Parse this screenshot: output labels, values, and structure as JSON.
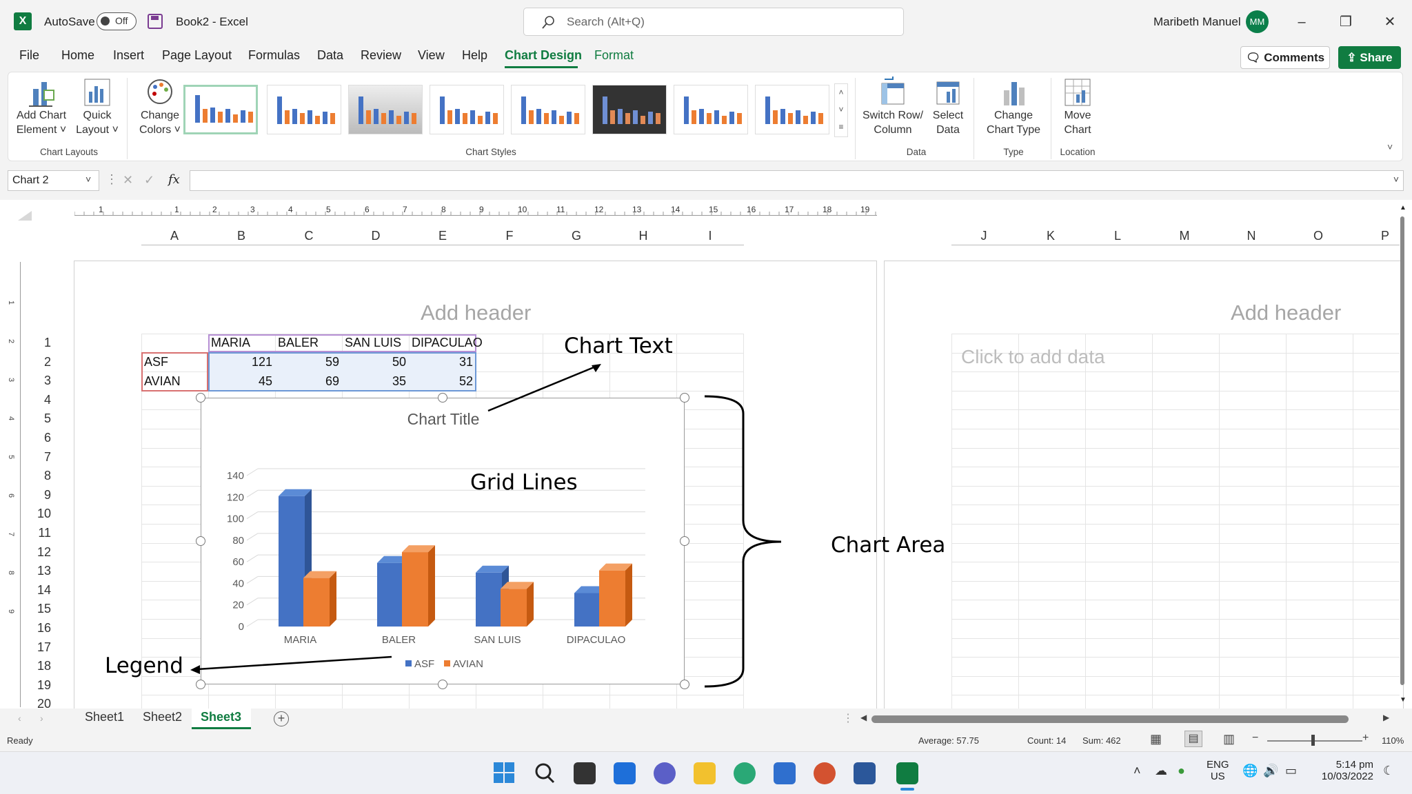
{
  "window": {
    "autosave_label": "AutoSave",
    "autosave_state": "Off",
    "title": "Book2  -  Excel",
    "search_placeholder": "Search (Alt+Q)",
    "user_name": "Maribeth Manuel",
    "user_initials": "MM"
  },
  "tabs": [
    "File",
    "Home",
    "Insert",
    "Page Layout",
    "Formulas",
    "Data",
    "Review",
    "View",
    "Help",
    "Chart Design",
    "Format"
  ],
  "actions": {
    "comments": "Comments",
    "share": "Share"
  },
  "ribbon": {
    "add_chart_element": [
      "Add Chart",
      "Element ˅"
    ],
    "quick_layout": [
      "Quick",
      "Layout ˅"
    ],
    "change_colors": [
      "Change",
      "Colors ˅"
    ],
    "switch_row_col": [
      "Switch Row/",
      "Column"
    ],
    "select_data": [
      "Select",
      "Data"
    ],
    "change_chart_type": [
      "Change",
      "Chart Type"
    ],
    "move_chart": [
      "Move",
      "Chart"
    ],
    "groups": {
      "chart_layouts": "Chart Layouts",
      "chart_styles": "Chart Styles",
      "data": "Data",
      "type": "Type",
      "location": "Location"
    }
  },
  "formula_bar": {
    "name_box": "Chart 2",
    "fx": "fx",
    "value": ""
  },
  "ruler_numbers": [
    "1",
    "1",
    "2",
    "3",
    "4",
    "5",
    "6",
    "7",
    "8",
    "9",
    "10",
    "11",
    "12",
    "13",
    "14",
    "15",
    "16",
    "17",
    "18",
    "19"
  ],
  "ruler_left_numbers": [
    "1",
    "2",
    "3",
    "4",
    "5",
    "6",
    "7",
    "8",
    "9"
  ],
  "columns_left": [
    "A",
    "B",
    "C",
    "D",
    "E",
    "F",
    "G",
    "H",
    "I"
  ],
  "columns_right": [
    "J",
    "K",
    "L",
    "M",
    "N",
    "O",
    "P"
  ],
  "rows": [
    "1",
    "2",
    "3",
    "4",
    "5",
    "6",
    "7",
    "8",
    "9",
    "10",
    "11",
    "12",
    "13",
    "14",
    "15",
    "16",
    "17",
    "18",
    "19",
    "20"
  ],
  "page": {
    "header_left": "Add header",
    "header_right": "Add header",
    "click_to_add": "Click to add data"
  },
  "table": {
    "headers": [
      "MARIA",
      "BALER",
      "SAN LUIS",
      "DIPACULAO"
    ],
    "rows": [
      {
        "label": "ASF",
        "values": [
          "121",
          "59",
          "50",
          "31"
        ]
      },
      {
        "label": "AVIAN",
        "values": [
          "45",
          "69",
          "35",
          "52"
        ]
      }
    ]
  },
  "annotations": {
    "chart_text": "Chart Text",
    "grid_lines": "Grid Lines",
    "chart_area": "Chart Area",
    "legend": "Legend"
  },
  "chart_data": {
    "type": "bar",
    "title": "Chart Title",
    "categories": [
      "MARIA",
      "BALER",
      "SAN LUIS",
      "DIPACULAO"
    ],
    "series": [
      {
        "name": "ASF",
        "values": [
          121,
          59,
          50,
          31
        ],
        "color": "#4472c4"
      },
      {
        "name": "AVIAN",
        "values": [
          45,
          69,
          35,
          52
        ],
        "color": "#ed7d31"
      }
    ],
    "ylim": [
      0,
      140
    ],
    "yticks": [
      "0",
      "20",
      "40",
      "60",
      "80",
      "100",
      "120",
      "140"
    ],
    "grid": true,
    "legend": "bottom",
    "xlabel": "",
    "ylabel": ""
  },
  "sheet_tabs": [
    "Sheet1",
    "Sheet2",
    "Sheet3"
  ],
  "active_sheet": "Sheet3",
  "status": {
    "ready": "Ready",
    "average": "Average: 57.75",
    "count": "Count: 14",
    "sum": "Sum: 462",
    "zoom": "110%"
  },
  "taskbar": {
    "lang": "ENG",
    "region": "US",
    "time": "5:14 pm",
    "date": "10/03/2022"
  },
  "colors": {
    "accent": "#107c41",
    "asf": "#4472c4",
    "avian": "#ed7d31"
  }
}
